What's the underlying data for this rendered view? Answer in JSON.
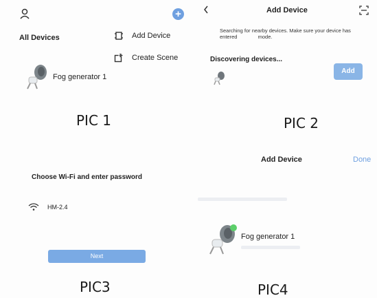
{
  "pic1": {
    "caption": "PIC 1",
    "all_devices_label": "All Devices",
    "menu": {
      "add_device_label": "Add Device",
      "create_scene_label": "Create Scene"
    },
    "device_name": "Fog generator 1",
    "icons": [
      "person-icon",
      "plus-icon",
      "add-device-icon",
      "create-scene-icon",
      "device-image"
    ]
  },
  "pic2": {
    "caption": "PIC 2",
    "title": "Add Device",
    "search_line1": "Searching for nearby devices. Make sure your device has",
    "search_line2_a": "entered",
    "search_line2_b": "mode.",
    "discovering_label": "Discovering devices...",
    "add_button_label": "Add",
    "icons": [
      "back-chevron-icon",
      "scan-icon",
      "device-image"
    ]
  },
  "pic3": {
    "caption": "PIC3",
    "heading": "Choose Wi-Fi and enter password",
    "wifi_name": "HM-2.4",
    "next_button_label": "Next",
    "icons": [
      "wifi-icon"
    ]
  },
  "pic4": {
    "caption": "PIC4",
    "title": "Add Device",
    "done_label": "Done",
    "device_name": "Fog generator 1",
    "icons": [
      "device-image"
    ]
  },
  "colors": {
    "accent_blue": "#6fa0e0",
    "button_blue": "#8ab5e6",
    "done_blue": "#6fa0e0",
    "success_green": "#5ccf6a"
  }
}
